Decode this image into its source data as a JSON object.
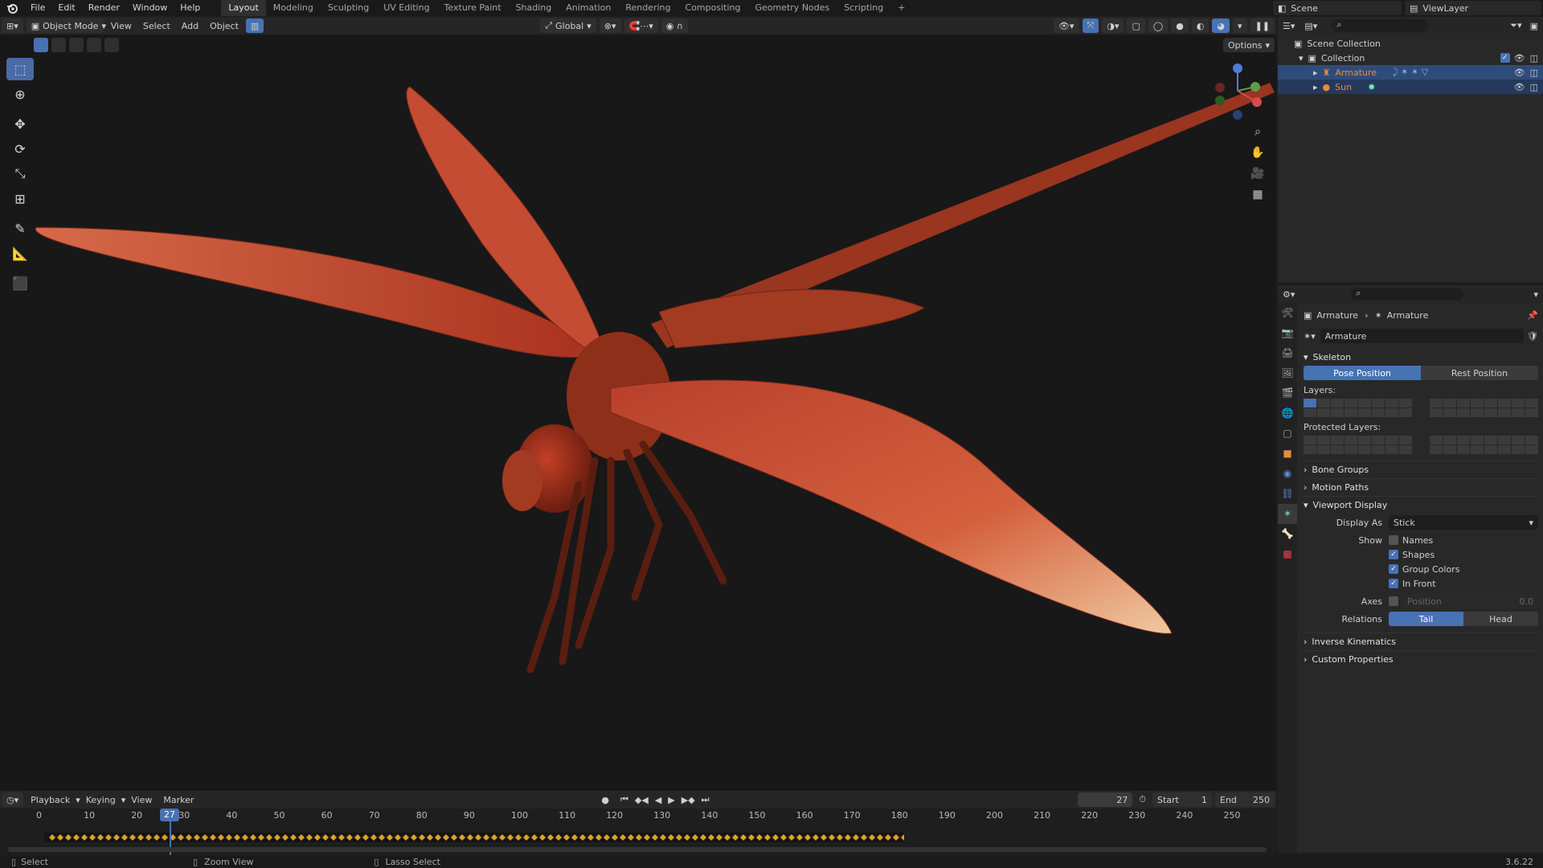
{
  "topbar": {
    "menus": [
      "File",
      "Edit",
      "Render",
      "Window",
      "Help"
    ],
    "workspaces": [
      "Layout",
      "Modeling",
      "Sculpting",
      "UV Editing",
      "Texture Paint",
      "Shading",
      "Animation",
      "Rendering",
      "Compositing",
      "Geometry Nodes",
      "Scripting"
    ],
    "add_tab": "+",
    "scene": "Scene",
    "view_layer": "ViewLayer"
  },
  "viewport_header": {
    "mode": "Object Mode",
    "menus": [
      "View",
      "Select",
      "Add",
      "Object"
    ],
    "orientation": "Global",
    "options": "Options"
  },
  "outliner": {
    "root": "Scene Collection",
    "collection": "Collection",
    "items": [
      {
        "name": "Armature",
        "color": "#e88b3c"
      },
      {
        "name": "Sun",
        "color": "#e88b3c"
      }
    ]
  },
  "properties": {
    "breadcrumb": [
      "Armature",
      "Armature"
    ],
    "datablock": "Armature",
    "skeleton": {
      "title": "Skeleton",
      "pose_position": "Pose Position",
      "rest_position": "Rest Position",
      "layers": "Layers:",
      "protected_layers": "Protected Layers:"
    },
    "bone_groups": "Bone Groups",
    "motion_paths": "Motion Paths",
    "viewport_display": {
      "title": "Viewport Display",
      "display_as_label": "Display As",
      "display_as": "Stick",
      "show_label": "Show",
      "names": "Names",
      "shapes": "Shapes",
      "group_colors": "Group Colors",
      "in_front": "In Front",
      "axes_label": "Axes",
      "position": "Position",
      "position_value": "0.0",
      "relations_label": "Relations",
      "tail": "Tail",
      "head": "Head"
    },
    "inverse_kinematics": "Inverse Kinematics",
    "custom_properties": "Custom Properties"
  },
  "timeline": {
    "menus": [
      "Playback",
      "Keying",
      "View",
      "Marker"
    ],
    "current_frame": "27",
    "start_label": "Start",
    "start": "1",
    "end_label": "End",
    "end": "250",
    "ticks": [
      "0",
      "10",
      "20",
      "30",
      "40",
      "50",
      "60",
      "70",
      "80",
      "90",
      "100",
      "110",
      "120",
      "130",
      "140",
      "150",
      "160",
      "170",
      "180",
      "190",
      "200",
      "210",
      "220",
      "230",
      "240",
      "250"
    ],
    "playhead": "27"
  },
  "statusbar": {
    "select": "Select",
    "zoom": "Zoom View",
    "lasso": "Lasso Select",
    "version": "3.6.22"
  },
  "colors": {
    "accent": "#4772b3",
    "selection": "#2f4b7a",
    "wing": "#c8543a",
    "body": "#a33a22"
  }
}
